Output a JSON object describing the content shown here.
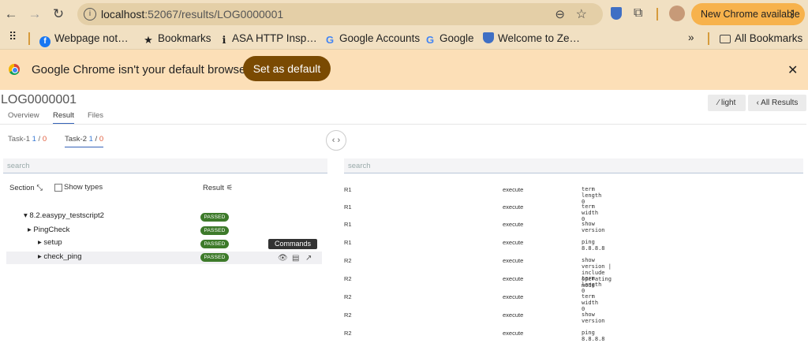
{
  "browser": {
    "url_host": "localhost",
    "url_rest": ":52067/results/LOG0000001",
    "new_chrome": "New Chrome available",
    "bookmarks": [
      {
        "label": "Webpage not…",
        "icon": "facebook-icon"
      },
      {
        "label": "Bookmarks",
        "icon": "star-icon"
      },
      {
        "label": "ASA HTTP Insp…",
        "icon": "folder-icon"
      },
      {
        "label": "Google Accounts",
        "icon": "google-icon"
      },
      {
        "label": "Google",
        "icon": "google-icon"
      },
      {
        "label": "Welcome to Ze…",
        "icon": "shield-icon"
      }
    ],
    "overflow": "»",
    "all_bookmarks": "All Bookmarks",
    "infobar": {
      "text": "Google Chrome isn't your default browser",
      "button": "Set as default"
    }
  },
  "page": {
    "title": "LOG0000001",
    "tabs": [
      "Overview",
      "Result",
      "Files"
    ],
    "light_btn": "light",
    "all_results_btn": "All Results",
    "tasks": [
      {
        "name": "Task-1",
        "a": "1",
        "b": "0"
      },
      {
        "name": "Task-2",
        "a": "1",
        "b": "0"
      }
    ],
    "search_placeholder": "search",
    "section_label": "Section",
    "show_types": "Show types",
    "result_label": "Result",
    "tree": [
      {
        "label": "8.2.easypy_testscript2",
        "status": "PASSED"
      },
      {
        "label": "PingCheck",
        "status": "PASSED"
      },
      {
        "label": "setup",
        "status": "PASSED"
      },
      {
        "label": "check_ping",
        "status": "PASSED"
      }
    ],
    "tooltip": "Commands",
    "commands": [
      {
        "device": "R1",
        "action": "execute",
        "command": "term length 0"
      },
      {
        "device": "R1",
        "action": "execute",
        "command": "term width 0"
      },
      {
        "device": "R1",
        "action": "execute",
        "command": "show version"
      },
      {
        "device": "R1",
        "action": "execute",
        "command": "ping 8.8.8.8"
      },
      {
        "device": "R2",
        "action": "execute",
        "command": "show version | include operating mode"
      },
      {
        "device": "R2",
        "action": "execute",
        "command": "term length 0"
      },
      {
        "device": "R2",
        "action": "execute",
        "command": "term width 0"
      },
      {
        "device": "R2",
        "action": "execute",
        "command": "show version"
      },
      {
        "device": "R2",
        "action": "execute",
        "command": "ping 8.8.8.8"
      }
    ]
  }
}
